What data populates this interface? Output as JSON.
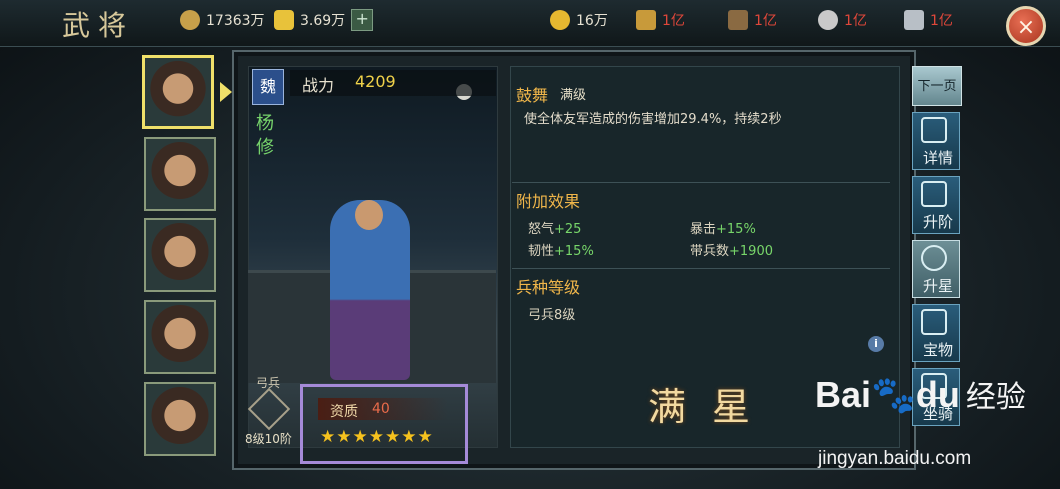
{
  "header": {
    "title": "武将",
    "resources": [
      {
        "icon": "coin-icon",
        "value": "17363万",
        "color": "#e6e1d2"
      },
      {
        "icon": "gold-ingot-icon",
        "value": "3.69万",
        "color": "#e6e1d2"
      },
      {
        "icon": "gold-pile-icon",
        "value": "16万",
        "color": "#e6e1d2"
      },
      {
        "icon": "grain-icon",
        "value": "1亿",
        "color": "#e0473a"
      },
      {
        "icon": "wood-icon",
        "value": "1亿",
        "color": "#e0473a"
      },
      {
        "icon": "stone-icon",
        "value": "1亿",
        "color": "#e0473a"
      },
      {
        "icon": "iron-icon",
        "value": "1亿",
        "color": "#e0473a"
      }
    ],
    "plus_label": "+",
    "close_label": "×"
  },
  "hero": {
    "emblem": "魏",
    "name": "杨修",
    "power_label": "战力",
    "power_value": "4209",
    "troop_type": "弓兵",
    "troop_level": "8级10阶",
    "aptitude_label": "资质",
    "aptitude_value": "40",
    "stars": "★★★★★★★"
  },
  "skill": {
    "name": "鼓舞",
    "level": "满级",
    "description": "使全体友军造成的伤害增加29.4%，持续2秒"
  },
  "bonus": {
    "title": "附加效果",
    "stats": [
      {
        "label": "怒气",
        "value": "+25"
      },
      {
        "label": "暴击",
        "value": "+15%"
      },
      {
        "label": "韧性",
        "value": "+15%"
      },
      {
        "label": "带兵数",
        "value": "+1900"
      }
    ]
  },
  "troop_level_section": {
    "title": "兵种等级",
    "value": "弓兵8级"
  },
  "max_star_text": "满星",
  "side_tabs": {
    "next": "下一页",
    "tabs": [
      "详情",
      "升阶",
      "升星",
      "宝物",
      "坐骑"
    ]
  },
  "info_icon": "i",
  "watermark": {
    "logo": "Bai🐾du",
    "text": "经验",
    "url": "jingyan.baidu.com"
  }
}
